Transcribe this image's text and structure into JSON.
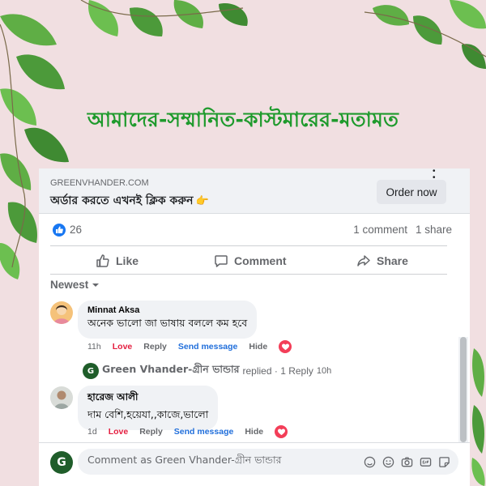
{
  "headline": "আমাদের-সম্মানিত-কাস্টমারের-মতামত",
  "ad": {
    "domain": "GREENVHANDER.COM",
    "text": "অর্ডার করতে এখনই ক্লিক করুন",
    "hand_icon": "pointing-hand-icon",
    "button_label": "Order now"
  },
  "stats": {
    "likes": "26",
    "comments": "1 comment",
    "shares": "1 share"
  },
  "actions": {
    "like": "Like",
    "comment": "Comment",
    "share": "Share"
  },
  "sort_label": "Newest",
  "comments": [
    {
      "name": "Minnat Aksa",
      "text": "অনেক ভালো জা ভাষায় বললে কম হবে",
      "time": "11h",
      "love": "Love",
      "reply": "Reply",
      "send": "Send message",
      "hide": "Hide"
    },
    {
      "name": "হারেজ আলী",
      "text": "দাম বেশি,হয়েযা,,কাজে,ভালো",
      "time": "1d",
      "love": "Love",
      "reply": "Reply",
      "send": "Send message",
      "hide": "Hide"
    }
  ],
  "page_reply": {
    "name": "Green Vhander-গ্রীন ভান্ডার",
    "action": "replied · 1 Reply",
    "time": "10h"
  },
  "composer": {
    "logo_letter": "G",
    "placeholder": "Comment as Green Vhander-গ্রীন ভান্ডার"
  },
  "colors": {
    "background": "#f1dfe1",
    "headline": "#1e9a2c",
    "facebook_blue": "#1877f2",
    "love_red": "#e41e3f",
    "send_blue": "#216fdb"
  }
}
